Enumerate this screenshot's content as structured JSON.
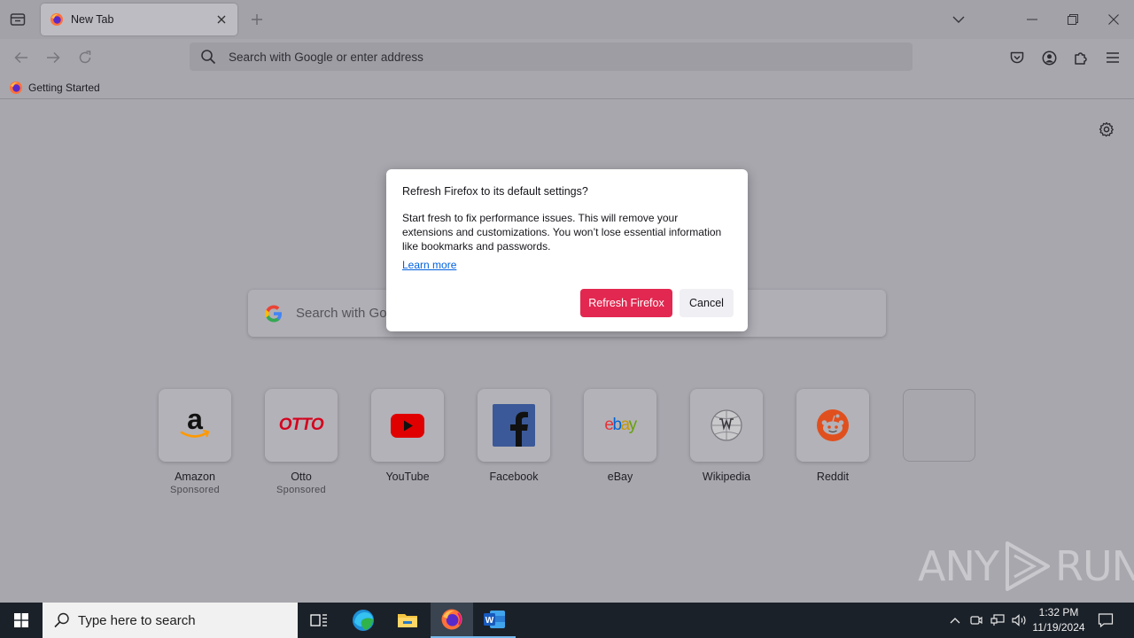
{
  "tabbar": {
    "active_tab_title": "New Tab"
  },
  "navbar": {
    "url_placeholder": "Search with Google or enter address"
  },
  "bookmarks": {
    "items": [
      {
        "label": "Getting Started"
      }
    ]
  },
  "content": {
    "search_placeholder": "Search with Google or enter address",
    "top_sites": [
      {
        "label": "Amazon",
        "sponsored": "Sponsored",
        "icon": "amazon-logo-icon"
      },
      {
        "label": "Otto",
        "sponsored": "Sponsored",
        "icon": "otto-logo-icon"
      },
      {
        "label": "YouTube",
        "icon": "youtube-logo-icon"
      },
      {
        "label": "Facebook",
        "icon": "facebook-logo-icon"
      },
      {
        "label": "eBay",
        "icon": "ebay-logo-icon"
      },
      {
        "label": "Wikipedia",
        "icon": "wikipedia-logo-icon"
      },
      {
        "label": "Reddit",
        "icon": "reddit-logo-icon"
      }
    ],
    "otto_logo_text": "OTTO",
    "ebay_logo": {
      "e": "e",
      "b": "b",
      "a": "a",
      "y": "y"
    }
  },
  "dialog": {
    "title": "Refresh Firefox to its default settings?",
    "body": "Start fresh to fix performance issues. This will remove your extensions and customizations. You won’t lose essential information like bookmarks and passwords.",
    "learn_more": "Learn more",
    "primary_button": "Refresh Firefox",
    "cancel_button": "Cancel"
  },
  "watermark": {
    "left": "ANY",
    "right": "RUN"
  },
  "taskbar": {
    "search_placeholder": "Type here to search",
    "time": "1:32 PM",
    "date": "11/19/2024"
  },
  "colors": {
    "accent_button": "#e22850",
    "link": "#0061e0",
    "taskbar": "#1b2129"
  }
}
